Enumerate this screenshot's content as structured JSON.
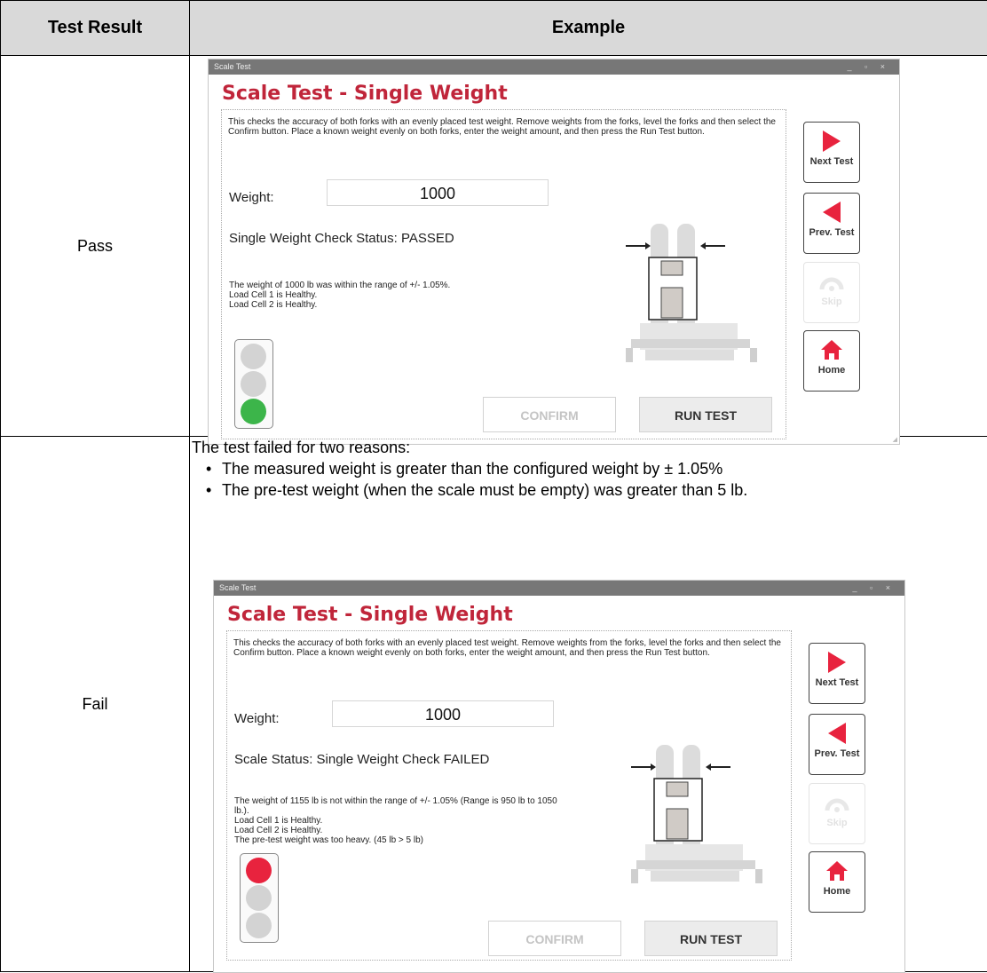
{
  "table": {
    "header_result": "Test Result",
    "header_example": "Example"
  },
  "rows": [
    {
      "result": "Pass",
      "window": {
        "window_title": "Scale Test",
        "heading": "Scale Test - Single Weight",
        "description": "This checks the accuracy of both forks with an evenly placed test weight. Remove weights from the forks, level the forks and then select the Confirm button. Place a known weight evenly on both forks, enter the weight amount, and then press the Run Test button.",
        "weight_label": "Weight:",
        "weight_value": "1000",
        "status": "Single Weight Check Status: PASSED",
        "message_lines": [
          "The weight of 1000 lb was within the range of +/- 1.05%.",
          "Load Cell 1 is Healthy.",
          "Load Cell 2 is Healthy."
        ],
        "confirm_label": "CONFIRM",
        "run_label": "RUN TEST",
        "next_label": "Next Test",
        "prev_label": "Prev. Test",
        "skip_label": "Skip",
        "home_label": "Home",
        "lamp_state": "green",
        "colors": {
          "lit": "#3cb54a",
          "off": "#d3d3d3"
        }
      }
    },
    {
      "result": "Fail",
      "intro": {
        "lead": "The test failed for two reasons:",
        "bullets": [
          "The measured weight is greater than the configured weight by ± 1.05%",
          "The pre-test weight (when the scale must be empty) was greater than 5 lb."
        ]
      },
      "window": {
        "window_title": "Scale Test",
        "heading": "Scale Test - Single Weight",
        "description": "This checks the accuracy of both forks with an evenly placed test weight. Remove weights from the forks, level the forks and then select the Confirm button. Place a known weight evenly on both forks, enter the weight amount, and then press the Run Test button.",
        "weight_label": "Weight:",
        "weight_value": "1000",
        "status": "Scale Status: Single Weight Check FAILED",
        "message_lines": [
          "The weight of 1155 lb is not within the range of +/- 1.05% (Range is 950 lb to 1050",
          "lb.).",
          "Load Cell 1 is Healthy.",
          "Load Cell 2 is Healthy.",
          "The pre-test weight was too heavy. (45 lb > 5 lb)"
        ],
        "confirm_label": "CONFIRM",
        "run_label": "RUN TEST",
        "next_label": "Next Test",
        "prev_label": "Prev. Test",
        "skip_label": "Skip",
        "home_label": "Home",
        "lamp_state": "red",
        "colors": {
          "lit": "#e8233e",
          "off": "#d3d3d3"
        }
      }
    }
  ],
  "icons": {
    "next": "play-right-icon",
    "prev": "play-left-icon",
    "skip": "gauge-icon",
    "home": "home-icon"
  },
  "accent_red": "#e8233e",
  "heading_red": "#c0253a"
}
